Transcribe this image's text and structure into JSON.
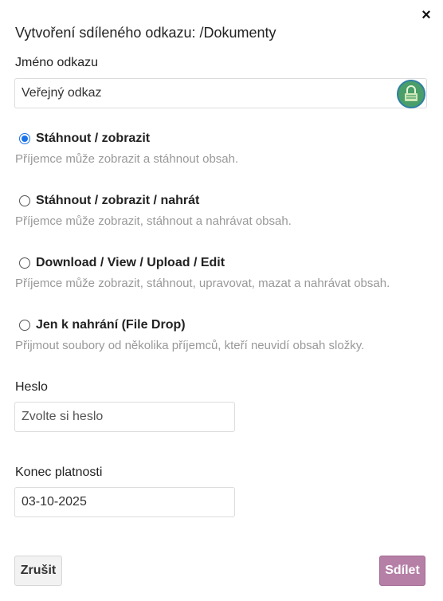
{
  "dialog": {
    "title": "Vytvoření sdíleného odkazu: /Dokumenty",
    "close_icon": "×"
  },
  "link_name": {
    "label": "Jméno odkazu",
    "value": "Veřejný odkaz",
    "lock_icon": "lock-icon"
  },
  "permissions": [
    {
      "label": "Stáhnout / zobrazit",
      "description": "Příjemce může zobrazit a stáhnout obsah.",
      "checked": true
    },
    {
      "label": "Stáhnout / zobrazit / nahrát",
      "description": "Příjemce může zobrazit, stáhnout a nahrávat obsah.",
      "checked": false
    },
    {
      "label": "Download / View / Upload / Edit",
      "description": "Příjemce může zobrazit, stáhnout, upravovat, mazat a nahrávat obsah.",
      "checked": false
    },
    {
      "label": "Jen k nahrání (File Drop)",
      "description": "Přijmout soubory od několika příjemců, kteří neuvidí obsah složky.",
      "checked": false
    }
  ],
  "password": {
    "label": "Heslo",
    "placeholder": "Zvolte si heslo",
    "value": ""
  },
  "expiry": {
    "label": "Konec platnosti",
    "value": "03-10-2025"
  },
  "buttons": {
    "cancel": "Zrušit",
    "share": "Sdílet"
  },
  "colors": {
    "accent_radio": "#1a73e8",
    "share_button": "#b57fa6",
    "lock_badge": "#4a9e6a"
  }
}
